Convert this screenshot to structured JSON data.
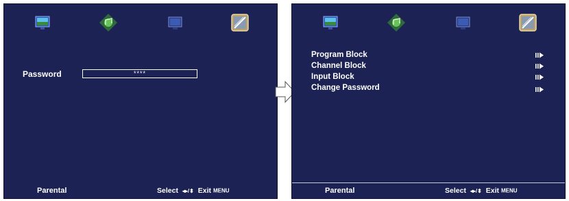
{
  "menu_icons": [
    {
      "name": "picture-menu-icon"
    },
    {
      "name": "sound-menu-icon"
    },
    {
      "name": "channel-menu-icon"
    },
    {
      "name": "parental-menu-icon",
      "selected": true
    }
  ],
  "left_screen": {
    "password_label": "Password",
    "password_value": "****",
    "footer": {
      "title": "Parental",
      "select_label": "Select",
      "nav_glyphs": "◂▸/⬍",
      "exit_label": "Exit",
      "menu_label": "MENU"
    }
  },
  "right_screen": {
    "items": [
      {
        "label": "Program Block"
      },
      {
        "label": "Channel Block"
      },
      {
        "label": "Input Block"
      },
      {
        "label": "Change Password"
      }
    ],
    "footer": {
      "title": "Parental",
      "select_label": "Select",
      "nav_glyphs": "◂▸/⬍",
      "exit_label": "Exit",
      "menu_label": "MENU"
    }
  },
  "colors": {
    "screen_background": "#1c2253",
    "text": "#ffffff",
    "transition_arrow": "#ffffff"
  }
}
